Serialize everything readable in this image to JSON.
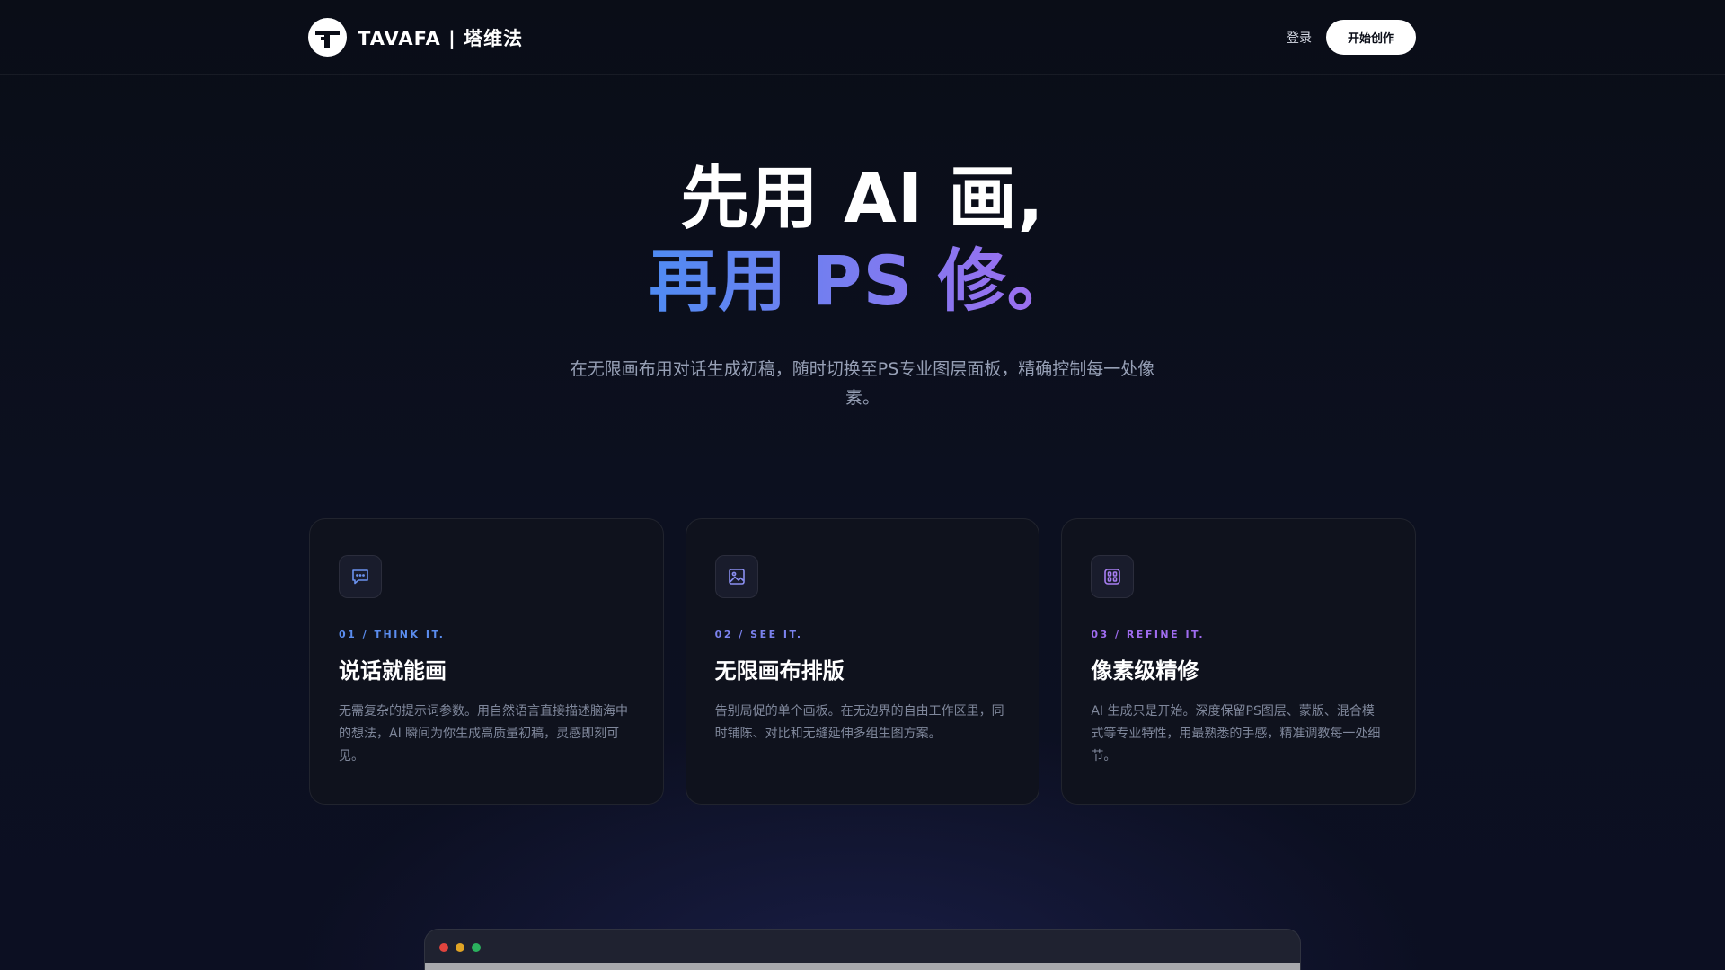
{
  "navbar": {
    "brand_name": "TAVAFA | 塔维法",
    "logo_icon": "tavafa-logo-icon",
    "login_label": "登录",
    "cta_label": "开始创作"
  },
  "hero": {
    "line1": "先用 AI 画,",
    "line2": "再用 PS 修。",
    "subtitle": "在无限画布用对话生成初稿，随时切换至PS专业图层面板，精确控制每一处像素。"
  },
  "features": [
    {
      "icon": "chat-bubble-icon",
      "step": "01 / THINK IT.",
      "step_color": "#5b8def",
      "title": "说话就能画",
      "description": "无需复杂的提示词参数。用自然语言直接描述脑海中的想法，AI 瞬间为你生成高质量初稿，灵感即刻可见。"
    },
    {
      "icon": "image-frame-icon",
      "step": "02 / SEE IT.",
      "step_color": "#7b82ee",
      "title": "无限画布排版",
      "description": "告别局促的单个画板。在无边界的自由工作区里，同时铺陈、对比和无缝延伸多组生图方案。"
    },
    {
      "icon": "control-panel-icon",
      "step": "03 / REFINE IT.",
      "step_color": "#a06cf0",
      "title": "像素级精修",
      "description": "AI 生成只是开始。深度保留PS图层、蒙版、混合模式等专业特性，用最熟悉的手感，精准调教每一处细节。"
    }
  ],
  "colors": {
    "background": "#0a0d17",
    "card_background": "#0f121d",
    "gradient_start": "#4f8bf2",
    "gradient_end": "#a36cf0"
  }
}
